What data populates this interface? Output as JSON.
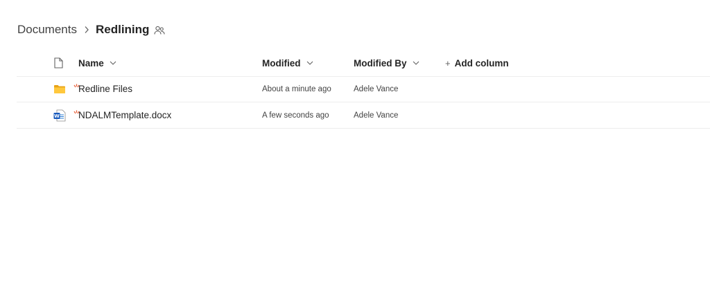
{
  "breadcrumb": {
    "parent": "Documents",
    "current": "Redlining"
  },
  "columns": {
    "name": "Name",
    "modified": "Modified",
    "modified_by": "Modified By",
    "add_column": "Add column",
    "add_column_prefix": "+"
  },
  "files": [
    {
      "name": "Redline Files",
      "type": "folder",
      "icon": "folder-icon",
      "modified": "About a minute ago",
      "modified_by": "Adele Vance",
      "is_new": true
    },
    {
      "name": "NDALMTemplate.docx",
      "type": "word-document",
      "icon": "word-document-icon",
      "modified": "A few seconds ago",
      "modified_by": "Adele Vance",
      "is_new": true
    }
  ],
  "colors": {
    "folder": "#ffb900",
    "word_blue": "#185abd",
    "new_marker": "#e8613b",
    "divider": "#ededed"
  }
}
